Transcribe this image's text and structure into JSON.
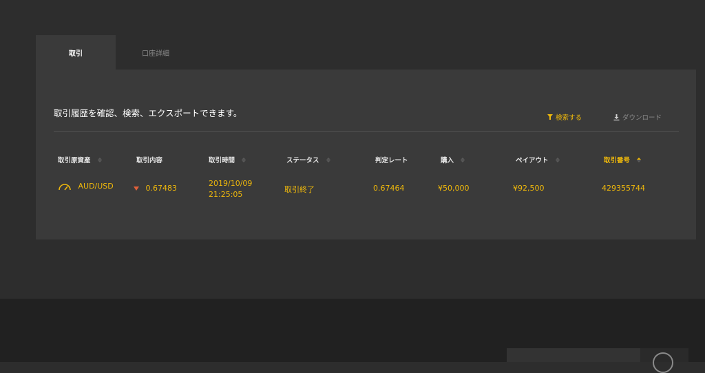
{
  "tabs": [
    {
      "label": "取引",
      "active": true
    },
    {
      "label": "口座詳細",
      "active": false
    }
  ],
  "panel": {
    "description": "取引履歴を確認、検索、エクスポートできます。",
    "search_label": "検索する",
    "download_label": "ダウンロード"
  },
  "table": {
    "headers": [
      "取引原資産",
      "取引内容",
      "取引時間",
      "ステータス",
      "判定レート",
      "購入",
      "ペイアウト",
      "取引番号"
    ],
    "rows": [
      {
        "asset": "AUD/USD",
        "direction": "down",
        "entry_rate": "0.67483",
        "time_date": "2019/10/09",
        "time_clock": "21:25:05",
        "status": "取引終了",
        "judge_rate": "0.67464",
        "purchase": "¥50,000",
        "payout": "¥92,500",
        "trade_id": "429355744"
      }
    ]
  },
  "colors": {
    "accent": "#f0b90b",
    "down": "#e0603a",
    "panel": "#3a3a3a",
    "background": "#2d2d2d"
  }
}
